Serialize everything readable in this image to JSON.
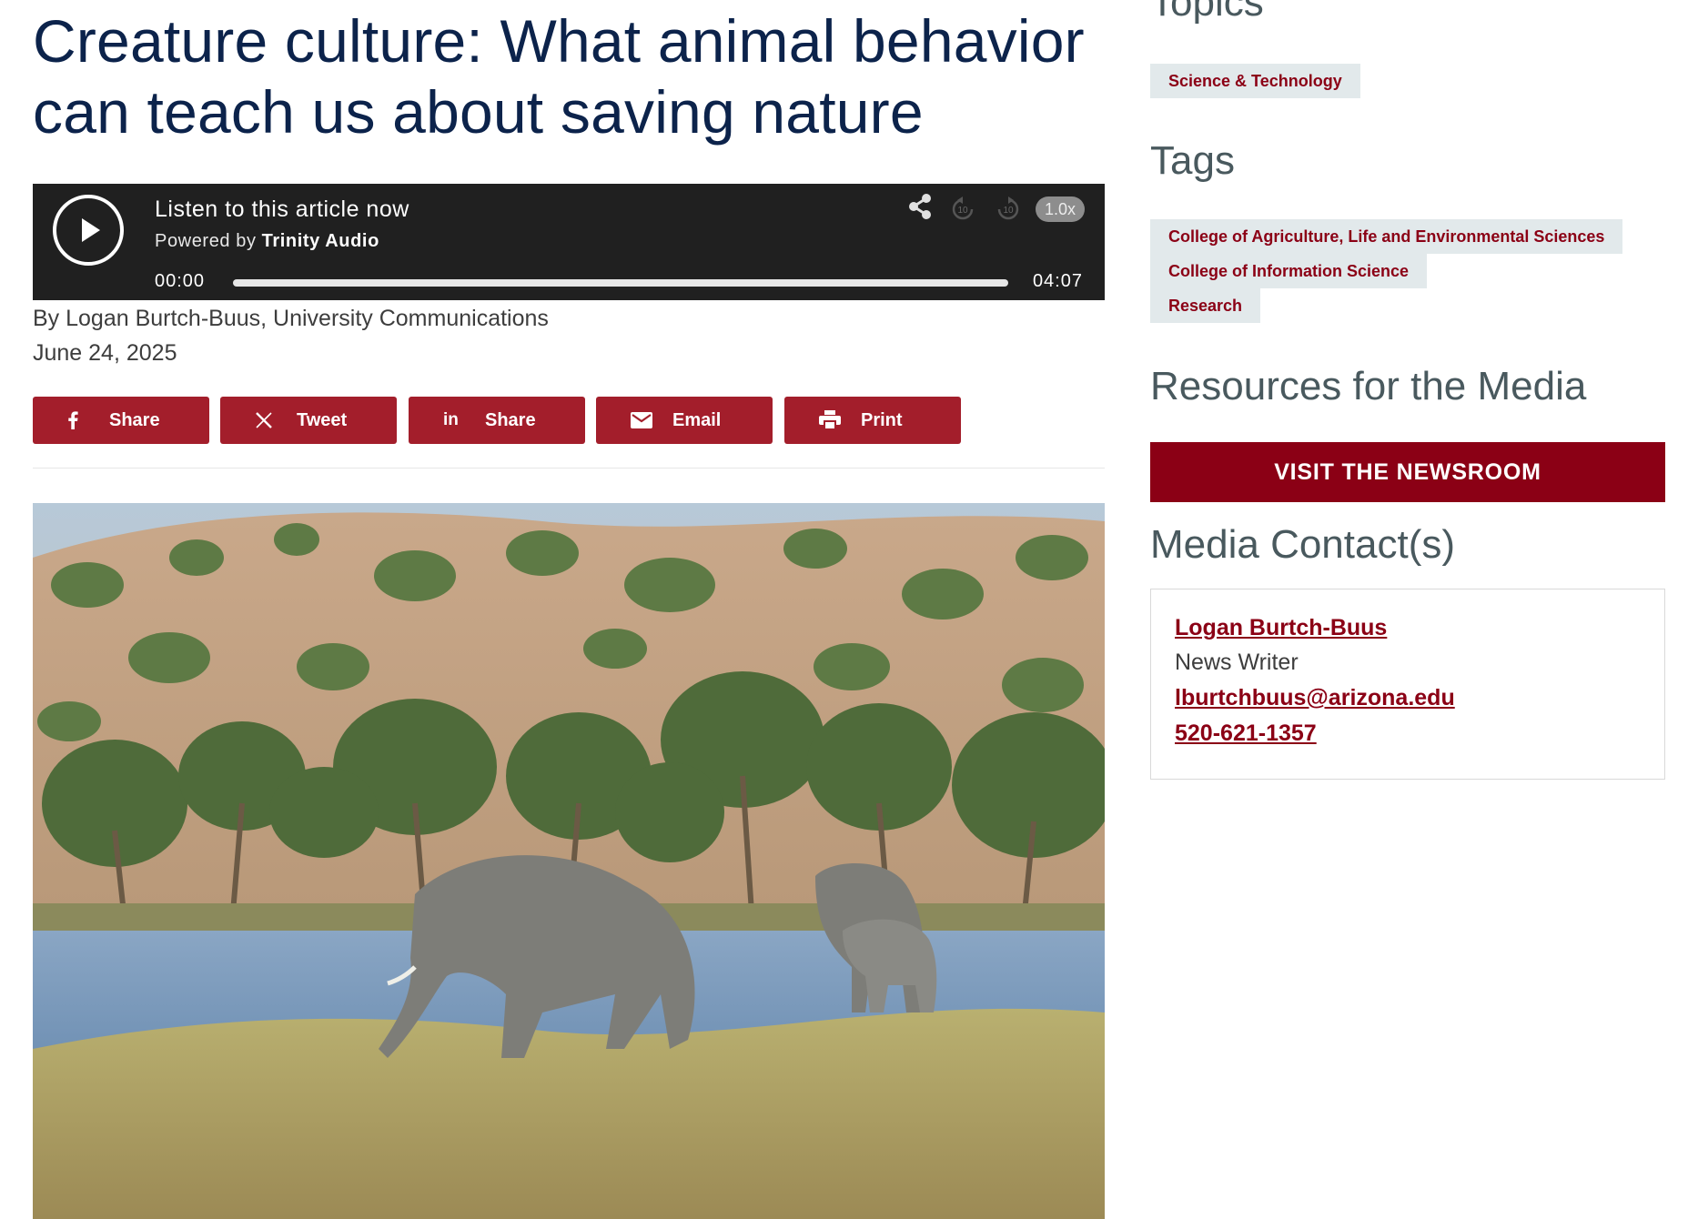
{
  "article": {
    "title": "Creature culture: What animal behavior can teach us about saving nature",
    "byline": "By Logan Burtch-Buus, University Communications",
    "date": "June 24, 2025"
  },
  "audio_player": {
    "title": "Listen to this article now",
    "powered_by_label": "Powered by",
    "powered_by_brand": "Trinity Audio",
    "time_current": "00:00",
    "time_total": "04:07",
    "speed": "1.0x",
    "progress": 0,
    "rewind_seconds": "10",
    "forward_seconds": "10",
    "icons": [
      "play-icon",
      "share-icon",
      "rewind-10-icon",
      "forward-10-icon"
    ]
  },
  "share_buttons": [
    {
      "icon": "facebook-icon",
      "label": "Share"
    },
    {
      "icon": "x-icon",
      "label": "Tweet"
    },
    {
      "icon": "linkedin-icon",
      "label": "Share"
    },
    {
      "icon": "email-icon",
      "label": "Email"
    },
    {
      "icon": "print-icon",
      "label": "Print"
    }
  ],
  "sidebar": {
    "topics_heading": "Topics",
    "topics": [
      "Science & Technology"
    ],
    "tags_heading": "Tags",
    "tags": [
      "College of Agriculture, Life and Environmental Sciences",
      "College of Information Science",
      "Research"
    ],
    "media_heading": "Resources for the Media",
    "newsroom_button": "VISIT THE NEWSROOM",
    "contacts_heading": "Media Contact(s)",
    "contact": {
      "name": "Logan Burtch-Buus",
      "role": "News Writer",
      "email": "lburtchbuus@arizona.edu",
      "phone": "520-621-1357"
    }
  },
  "colors": {
    "title": "#0c234b",
    "button_red": "#a31e2b",
    "brand_dark_red": "#8b0015",
    "sidebar_heading": "#49595e",
    "tag_bg": "#e2e9eb",
    "player_bg": "#202020"
  }
}
